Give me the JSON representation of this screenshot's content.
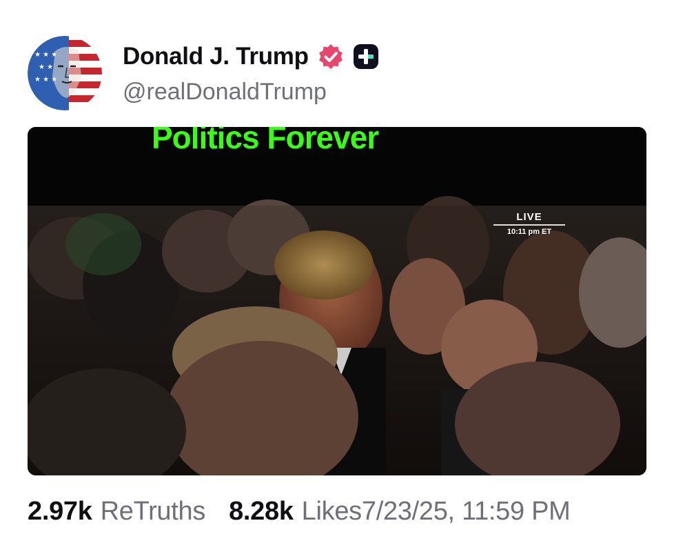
{
  "author": {
    "display_name": "Donald J. Trump",
    "handle": "@realDonaldTrump",
    "avatar_icon": "flag-portrait-avatar",
    "verified_icon": "verified-badge-icon",
    "verified_color": "#e8466c",
    "plus_icon": "plus-badge-icon"
  },
  "media": {
    "type": "video",
    "caption_text": "Politics Forever",
    "caption_color": "#39ff14",
    "live_label": "LIVE",
    "live_time": "10:11 pm ET"
  },
  "stats": {
    "retruths_count": "2.97k",
    "retruths_label": "ReTruths",
    "likes_count": "8.28k",
    "likes_label": "Likes",
    "timestamp": "7/23/25, 11:59 PM"
  }
}
